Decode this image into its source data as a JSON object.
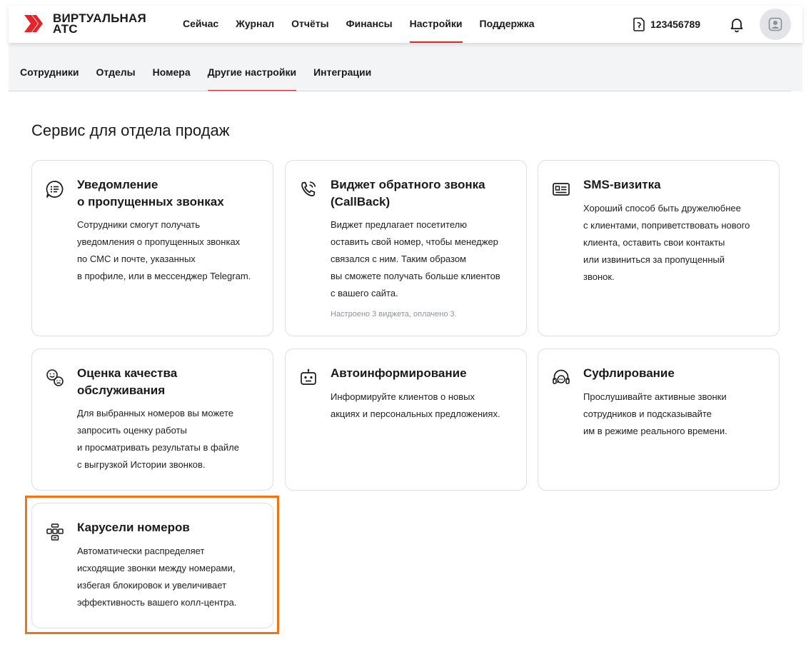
{
  "brand": {
    "line1": "ВИРТУАЛЬНАЯ",
    "line2": "АТС",
    "color": "#e3242b"
  },
  "main_nav": [
    {
      "label": "Сейчас",
      "active": false
    },
    {
      "label": "Журнал",
      "active": false
    },
    {
      "label": "Отчёты",
      "active": false
    },
    {
      "label": "Финансы",
      "active": false
    },
    {
      "label": "Настройки",
      "active": true
    },
    {
      "label": "Поддержка",
      "active": false
    }
  ],
  "account": {
    "number": "123456789",
    "icon": "sim-card-icon"
  },
  "header_icons": {
    "notifications": "bell-icon",
    "profile": "avatar-icon"
  },
  "sub_nav": [
    {
      "label": "Сотрудники",
      "active": false
    },
    {
      "label": "Отделы",
      "active": false
    },
    {
      "label": "Номера",
      "active": false
    },
    {
      "label": "Другие настройки",
      "active": true
    },
    {
      "label": "Интеграции",
      "active": false
    }
  ],
  "section": {
    "title": "Сервис для отдела продаж"
  },
  "cards": [
    {
      "id": "missed-calls",
      "icon": "chat-list-icon",
      "title_lines": [
        "Уведомление",
        "о пропущенных звонках"
      ],
      "desc_lines": [
        "Сотрудники смогут получать",
        "уведомления о пропущенных звонках",
        "по СМС и почте, указанных",
        "в профиле, или в мессенджер Telegram."
      ]
    },
    {
      "id": "callback",
      "icon": "phone-callback-icon",
      "title_lines": [
        "Виджет обратного звонка",
        "(CallBack)"
      ],
      "desc_lines": [
        "Виджет предлагает посетителю",
        "оставить свой номер, чтобы менеджер",
        "связался с ним. Таким образом",
        "вы сможете получать больше клиентов",
        "с вашего сайта."
      ],
      "note": "Настроено 3 виджета, оплачено 3."
    },
    {
      "id": "sms-card",
      "icon": "business-card-icon",
      "title_lines": [
        "SMS-визитка"
      ],
      "desc_lines": [
        "Хороший способ быть дружелюбнее",
        "с клиентами, поприветствовать нового",
        "клиента, оставить свои контакты",
        "или извиниться за пропущенный",
        "звонок."
      ]
    },
    {
      "id": "quality",
      "icon": "smiley-rating-icon",
      "title_lines": [
        "Оценка качества",
        "обслуживания"
      ],
      "desc_lines": [
        "Для выбранных номеров вы можете",
        "запросить оценку работы",
        "и просматривать результаты в файле",
        "с выгрузкой Истории звонков."
      ]
    },
    {
      "id": "autoinform",
      "icon": "robot-icon",
      "title_lines": [
        "Автоинформирование"
      ],
      "desc_lines": [
        "Информируйте клиентов о новых",
        "акциях и персональных предложениях."
      ]
    },
    {
      "id": "prompting",
      "icon": "headset-icon",
      "title_lines": [
        "Суфлирование"
      ],
      "desc_lines": [
        "Прослушивайте активные звонки",
        "сотрудников и подсказывайте",
        "им в режиме реального времени."
      ]
    },
    {
      "id": "carousel",
      "icon": "number-carousel-icon",
      "title_lines": [
        "Карусели номеров"
      ],
      "desc_lines": [
        "Автоматически распределяет",
        "исходящие звонки между номерами,",
        "избегая блокировок и увеличивает",
        "эффективность вашего колл-центра."
      ]
    }
  ],
  "colors": {
    "accent": "#e3242b",
    "highlight": "#f07316",
    "card_border": "#dcdfe3"
  }
}
